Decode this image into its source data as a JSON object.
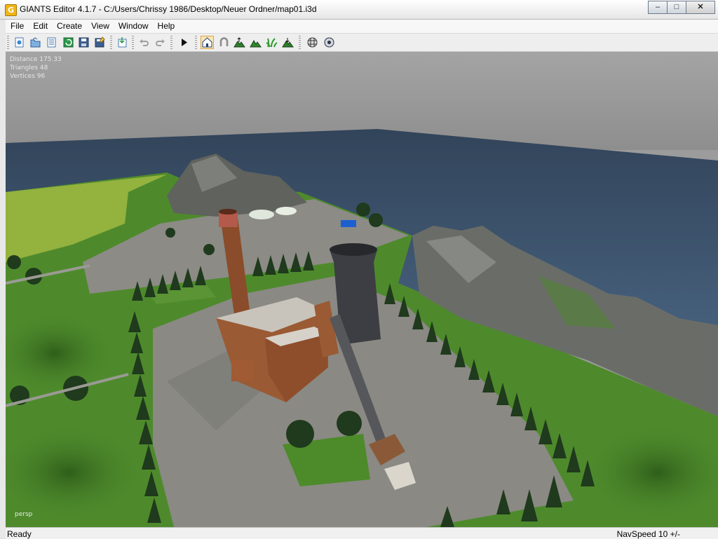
{
  "window": {
    "app_icon_letter": "G",
    "title": "GIANTS Editor 4.1.7 - C:/Users/Chrissy 1986/Desktop/Neuer Ordner/map01.i3d",
    "minimize": "–",
    "maximize": "□",
    "close": "✕"
  },
  "menu": {
    "file": "File",
    "edit": "Edit",
    "create": "Create",
    "view": "View",
    "window": "Window",
    "help": "Help"
  },
  "toolbar": {
    "icons": [
      "new-scene-icon",
      "open-icon",
      "scenegraph-icon",
      "reload-icon",
      "save-icon",
      "save-as-icon",
      "import-icon",
      "undo-icon",
      "redo-icon",
      "play-icon",
      "home-camera-icon",
      "magnet-icon",
      "terrain-raise-icon",
      "terrain-paint-icon",
      "foliage-paint-icon",
      "terrain-lower-icon",
      "render-settings-icon",
      "material-icon"
    ]
  },
  "viewport": {
    "stats": {
      "distance": "Distance 175.33",
      "triangles": "Triangles 48",
      "vertices": "Vertices 96"
    },
    "camera_mode": "persp",
    "colors": {
      "sky": "#9e9e9e",
      "water": "#3a4f66",
      "grass": "#4e8a2c",
      "field": "#8fb03c",
      "asphalt": "#8d8c86",
      "brick": "#9a5a34",
      "mountain": "#6e726c"
    }
  },
  "status": {
    "left": "Ready",
    "right": "NavSpeed 10 +/-"
  }
}
